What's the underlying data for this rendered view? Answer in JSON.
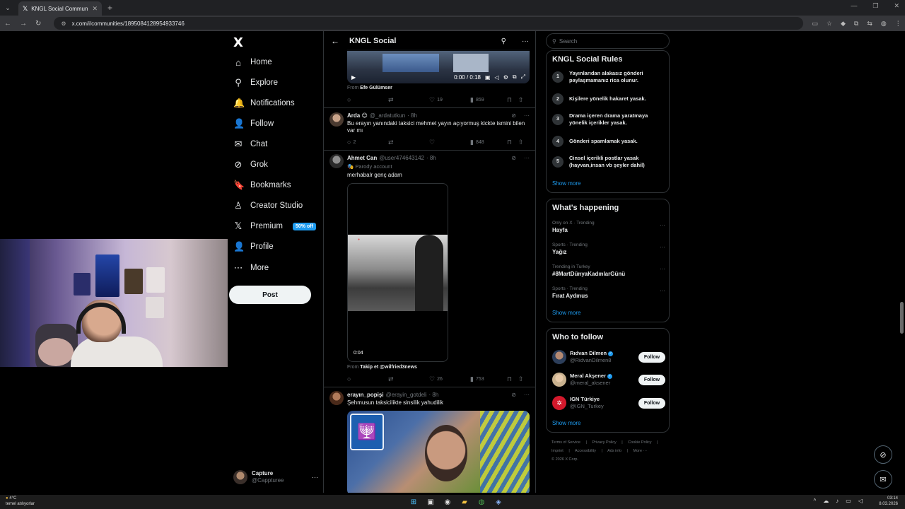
{
  "browser": {
    "tab_title": "KNGL Social Community / X",
    "tab_close": "✕",
    "new_tab": "+",
    "url": "x.com/i/communities/1895084128954933746"
  },
  "nav": {
    "logo": "X",
    "items": [
      {
        "label": "Home",
        "icon": "⌂"
      },
      {
        "label": "Explore",
        "icon": "⚲"
      },
      {
        "label": "Notifications",
        "icon": "🔔"
      },
      {
        "label": "Follow",
        "icon": "👤"
      },
      {
        "label": "Chat",
        "icon": "✉"
      },
      {
        "label": "Grok",
        "icon": "⊘"
      },
      {
        "label": "Bookmarks",
        "icon": "🔖"
      },
      {
        "label": "Creator Studio",
        "icon": "♙"
      },
      {
        "label": "Premium",
        "icon": "𝕏"
      },
      {
        "label": "Profile",
        "icon": "👤"
      },
      {
        "label": "More",
        "icon": "⋯"
      }
    ],
    "premium_badge": "50% off",
    "post_button": "Post",
    "account": {
      "name": "Capture",
      "handle": "@Cappturee",
      "more": "···"
    }
  },
  "feed": {
    "header_title": "KNGL Social",
    "top_video": {
      "time": "0:00 / 0:18"
    },
    "from_1": {
      "prefix": "From",
      "name": "Efe Gülümser"
    },
    "actions_1": {
      "replies": "",
      "reposts": "",
      "likes": "19",
      "views": "859"
    },
    "tweets": [
      {
        "name": "Arda 😊",
        "handle": "@_ardatutkun",
        "time": "· 8h",
        "text": "Bu erayın yanındaki taksici mehmet yayın açıyormuş kickte ismini bilen var mı",
        "replies": "2",
        "reposts": "",
        "likes": "",
        "views": "848"
      },
      {
        "name": "Ahmet Can",
        "handle": "@user474643142",
        "time": "· 8h",
        "parody": "🎭 Parody account",
        "text": "merhabalr genç adam",
        "video_time": "0:04",
        "from_prefix": "From",
        "from_name": "Takip et @wilfried3news",
        "replies": "",
        "reposts": "",
        "likes": "26",
        "views": "753"
      },
      {
        "name": "erayın_popişi",
        "handle": "@erayin_gotdeli",
        "time": "· 8h",
        "text": "Şehmusun taksicilikte sinsilik yahudilik"
      }
    ]
  },
  "sidebar": {
    "search_placeholder": "Search",
    "rules_title": "KNGL Social Rules",
    "rules": [
      {
        "num": "1",
        "text": "Yayınlarıdan alakasız gönderi paylaşmamanız rica olunur."
      },
      {
        "num": "2",
        "text": "Kişilere yönelik hakaret yasak."
      },
      {
        "num": "3",
        "text": "Drama içeren drama yaratmaya yönelik içerikler yasak."
      },
      {
        "num": "4",
        "text": "Gönderi spamlamak yasak."
      },
      {
        "num": "5",
        "text": "Cinsel içerikli postlar yasak (hayvan,insan vb şeyler dahil)"
      }
    ],
    "show_more": "Show more",
    "happening_title": "What's happening",
    "trends": [
      {
        "meta": "Only on X · Trending",
        "name": "Hayfa"
      },
      {
        "meta": "Sports · Trending",
        "name": "Yağız"
      },
      {
        "meta": "Trending in Turkey",
        "name": "#8MartDünyaKadınlarGünü"
      },
      {
        "meta": "Sports · Trending",
        "name": "Fırat Aydınus"
      }
    ],
    "follow_title": "Who to follow",
    "follows": [
      {
        "name": "Rıdvan Dilmen",
        "handle": "@RidvanDilmen8",
        "button": "Follow"
      },
      {
        "name": "Meral Akşener",
        "handle": "@meral_aksener",
        "button": "Follow"
      },
      {
        "name": "IGN Türkiye",
        "handle": "@IGN_Turkey",
        "button": "Follow"
      }
    ],
    "footer": [
      "Terms of Service",
      "|",
      "Privacy Policy",
      "|",
      "Cookie Policy",
      "|",
      "Imprint",
      "|",
      "Accessibility",
      "|",
      "Ads info",
      "|",
      "More ···",
      "© 2026 X Corp."
    ]
  },
  "taskbar": {
    "weather_temp": "4°C",
    "weather_text": "temel atılıyorlar",
    "time": "03:14",
    "date": "8.03.2026"
  }
}
